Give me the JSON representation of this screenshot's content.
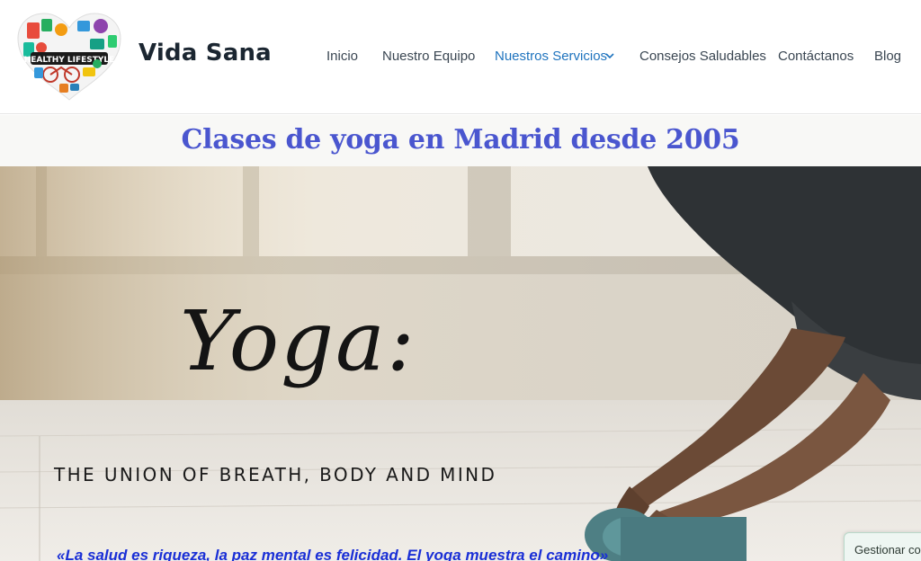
{
  "site": {
    "title": "Vida Sana",
    "logo_text": "HEALTHY LIFESTYLE"
  },
  "nav": {
    "items": [
      {
        "label": "Inicio"
      },
      {
        "label": "Nuestro Equipo"
      },
      {
        "label": "Nuestros Servicios",
        "active": true,
        "has_dropdown": true
      },
      {
        "label": "Consejos Saludables"
      },
      {
        "label": "Contáctanos"
      },
      {
        "label": "Blog"
      }
    ]
  },
  "page": {
    "heading": "Clases de yoga en Madrid desde 2005"
  },
  "hero": {
    "script_title": "Yoga:",
    "tagline": "THE UNION OF BREATH, BODY AND MIND"
  },
  "quote": {
    "text": "«La salud es riqueza, la paz mental es felicidad. El yoga muestra el camino»"
  },
  "cookie": {
    "label": "Gestionar co"
  },
  "colors": {
    "accent": "#1e73be",
    "heading": "#4a56cf",
    "quote": "#1a2fd6"
  }
}
